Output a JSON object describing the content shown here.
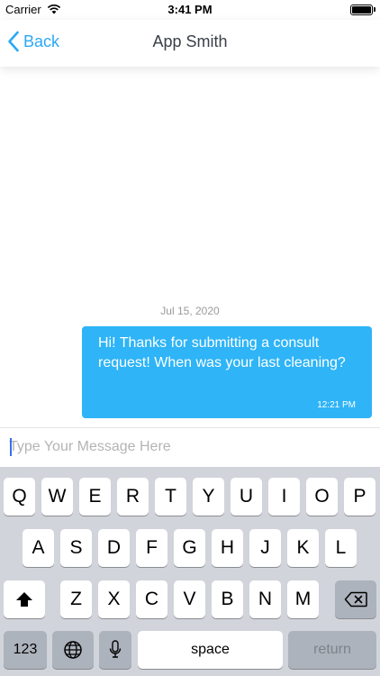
{
  "status_bar": {
    "carrier": "Carrier",
    "time": "3:41 PM",
    "battery_level": 1.0
  },
  "nav": {
    "back_label": "Back",
    "title": "App Smith",
    "accent_color": "#2aa9f4"
  },
  "chat": {
    "date_separator": "Jul 15, 2020",
    "messages": [
      {
        "text": "Hi!  Thanks for submitting a consult request!  When was your last cleaning?",
        "time": "12:21 PM",
        "bubble_color": "#2eb4f7"
      }
    ]
  },
  "composer": {
    "placeholder": "Type Your Message Here",
    "value": ""
  },
  "keyboard": {
    "row1": [
      "Q",
      "W",
      "E",
      "R",
      "T",
      "Y",
      "U",
      "I",
      "O",
      "P"
    ],
    "row2": [
      "A",
      "S",
      "D",
      "F",
      "G",
      "H",
      "J",
      "K",
      "L"
    ],
    "row3": [
      "Z",
      "X",
      "C",
      "V",
      "B",
      "N",
      "M"
    ],
    "numbers_label": "123",
    "space_label": "space",
    "return_label": "return",
    "icons": [
      "wifi-icon",
      "back-chevron-icon",
      "shift-icon",
      "delete-icon",
      "globe-icon",
      "microphone-icon"
    ]
  }
}
